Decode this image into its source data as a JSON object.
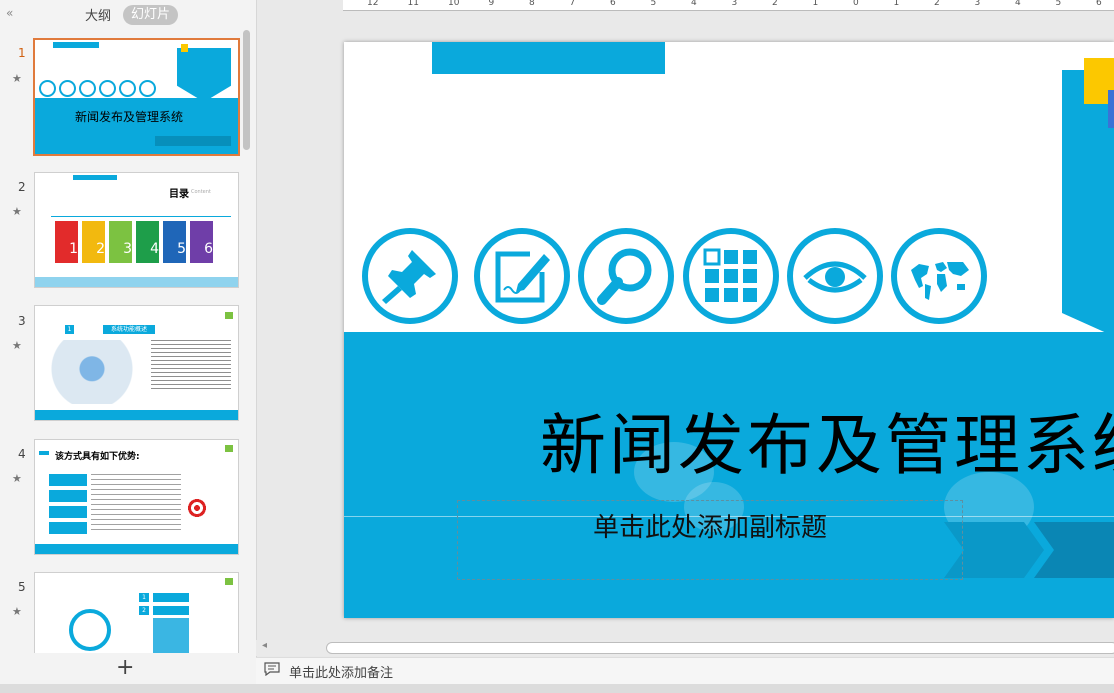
{
  "left_panel": {
    "collapse_glyph": "«",
    "tab_outline": "大纲",
    "tab_slides": "幻灯片",
    "add_slide_glyph": "+",
    "star_glyph": "★",
    "slides": [
      {
        "number": "1",
        "thumb_title": "新闻发布及管理系统"
      },
      {
        "number": "2",
        "thumb_title": "目录",
        "thumb_subtitle": "Content",
        "items": [
          "1",
          "2",
          "3",
          "4",
          "5",
          "6"
        ]
      },
      {
        "number": "3",
        "thumb_header": "系统功能概述",
        "thumb_index": "1"
      },
      {
        "number": "4",
        "thumb_title": "该方式具有如下优势:"
      },
      {
        "number": "5",
        "thumb_rows": [
          "1",
          "2"
        ]
      }
    ]
  },
  "ruler": {
    "ticks": [
      "12",
      "11",
      "10",
      "9",
      "8",
      "7",
      "6",
      "5",
      "4",
      "3",
      "2",
      "1",
      "0",
      "1",
      "2",
      "3",
      "4",
      "5",
      "6"
    ]
  },
  "slide": {
    "title": "新闻发布及管理系统",
    "subtitle_placeholder": "单击此处添加副标题",
    "colors": {
      "accent": "#0aa9dc",
      "yellow": "#fcc800",
      "blue": "#3a73d6"
    },
    "icons": [
      "pushpin-icon",
      "edit-note-icon",
      "search-icon",
      "grid-icon",
      "eye-icon",
      "world-map-icon"
    ]
  },
  "notes": {
    "placeholder": "单击此处添加备注"
  }
}
